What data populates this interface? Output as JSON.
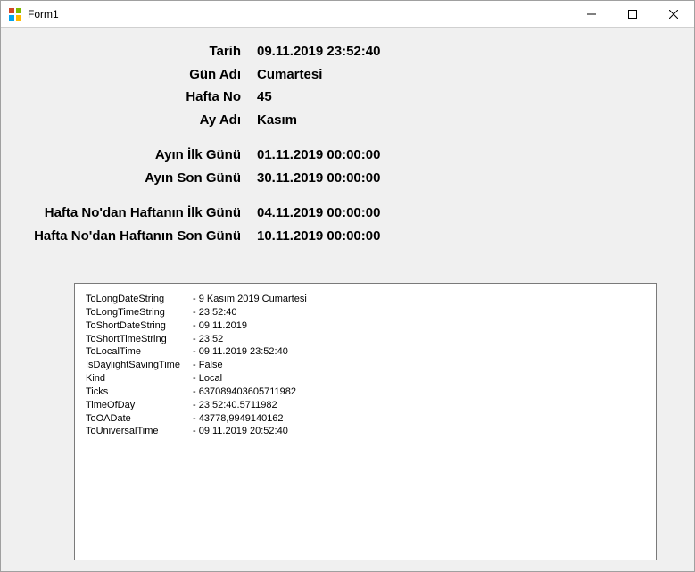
{
  "window": {
    "title": "Form1"
  },
  "info": {
    "rows": [
      {
        "label": "Tarih",
        "value": "09.11.2019 23:52:40"
      },
      {
        "label": "Gün Adı",
        "value": "Cumartesi"
      },
      {
        "label": "Hafta No",
        "value": "45"
      },
      {
        "label": "Ay Adı",
        "value": "Kasım"
      }
    ],
    "month_rows": [
      {
        "label": "Ayın İlk Günü",
        "value": "01.11.2019 00:00:00"
      },
      {
        "label": "Ayın Son Günü",
        "value": "30.11.2019 00:00:00"
      }
    ],
    "week_rows": [
      {
        "label": "Hafta No'dan Haftanın İlk Günü",
        "value": "04.11.2019 00:00:00"
      },
      {
        "label": "Hafta No'dan Haftanın Son Günü",
        "value": "10.11.2019 00:00:00"
      }
    ]
  },
  "details": [
    {
      "key": "ToLongDateString",
      "value": "- 9 Kasım 2019 Cumartesi"
    },
    {
      "key": "ToLongTimeString",
      "value": "- 23:52:40"
    },
    {
      "key": "ToShortDateString",
      "value": "- 09.11.2019"
    },
    {
      "key": "ToShortTimeString",
      "value": "- 23:52"
    },
    {
      "key": "ToLocalTime",
      "value": "- 09.11.2019 23:52:40"
    },
    {
      "key": "IsDaylightSavingTime",
      "value": "- False"
    },
    {
      "key": "Kind",
      "value": "- Local"
    },
    {
      "key": "Ticks",
      "value": "- 637089403605711982"
    },
    {
      "key": "TimeOfDay",
      "value": "- 23:52:40.5711982"
    },
    {
      "key": "ToOADate",
      "value": "- 43778,9949140162"
    },
    {
      "key": "ToUniversalTime",
      "value": "- 09.11.2019 20:52:40"
    }
  ]
}
